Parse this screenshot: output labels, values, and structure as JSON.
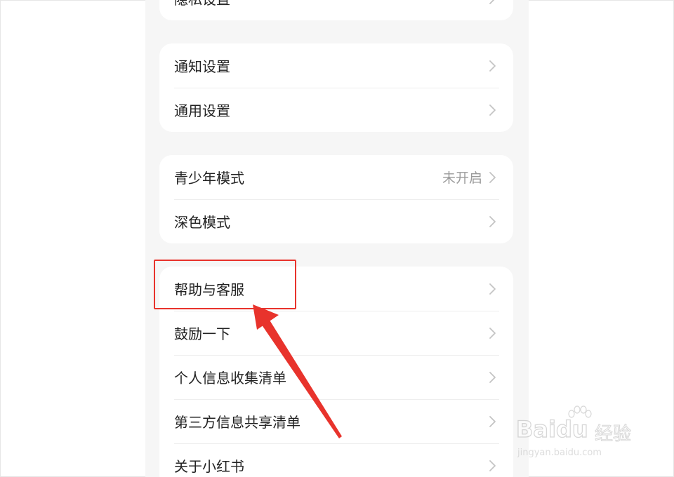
{
  "settings": {
    "group0": {
      "items": [
        {
          "label": "隐私设置",
          "value": ""
        }
      ]
    },
    "group1": {
      "items": [
        {
          "label": "通知设置",
          "value": ""
        },
        {
          "label": "通用设置",
          "value": ""
        }
      ]
    },
    "group2": {
      "items": [
        {
          "label": "青少年模式",
          "value": "未开启"
        },
        {
          "label": "深色模式",
          "value": ""
        }
      ]
    },
    "group3": {
      "items": [
        {
          "label": "帮助与客服",
          "value": ""
        },
        {
          "label": "鼓励一下",
          "value": ""
        },
        {
          "label": "个人信息收集清单",
          "value": ""
        },
        {
          "label": "第三方信息共享清单",
          "value": ""
        },
        {
          "label": "关于小红书",
          "value": ""
        }
      ]
    }
  },
  "annotation": {
    "highlight_color": "#e8332c",
    "target": "帮助与客服"
  },
  "watermark": {
    "brand": "Baidu",
    "suffix": "经验",
    "url": "jingyan.baidu.com"
  },
  "colors": {
    "page_bg": "#f6f6f6",
    "card_bg": "#ffffff",
    "text": "#222222",
    "secondary_text": "#9a9a9a",
    "chevron": "#c4c4c4"
  }
}
